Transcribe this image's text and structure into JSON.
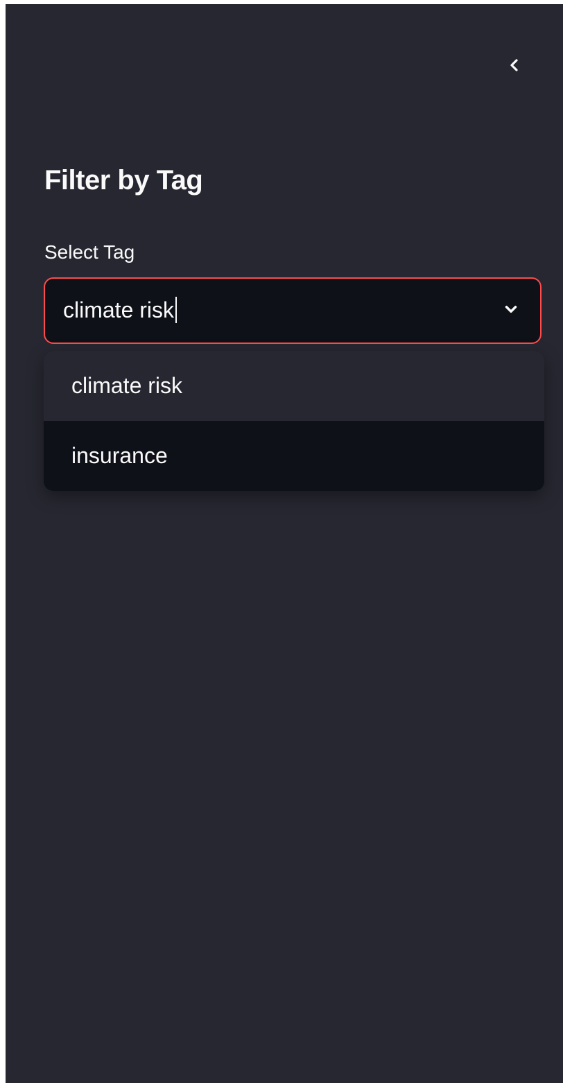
{
  "sidebar": {
    "collapse_icon": "chevron-left-icon",
    "title": "Filter by Tag",
    "select": {
      "label": "Select Tag",
      "value": "climate risk",
      "dropdown_icon": "chevron-down-icon",
      "options": [
        {
          "label": "climate risk",
          "highlighted": true
        },
        {
          "label": "insurance",
          "highlighted": false
        }
      ]
    }
  },
  "colors": {
    "sidebar_bg": "#262730",
    "input_bg": "#0e1117",
    "focus_border": "#ff4b4b",
    "text": "#fafafa"
  }
}
